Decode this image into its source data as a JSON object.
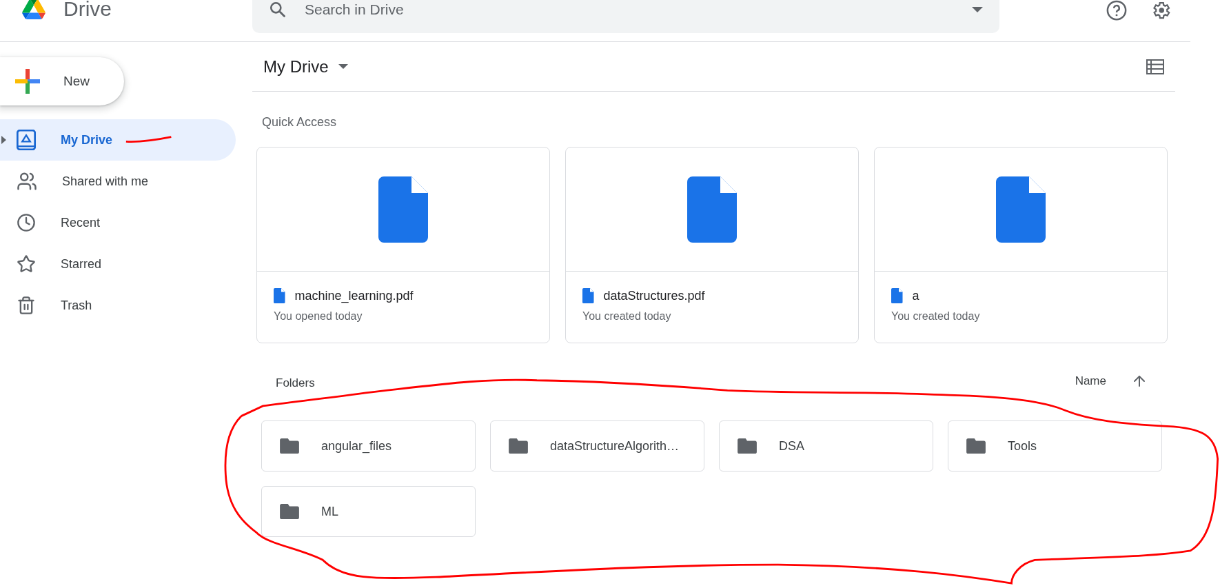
{
  "header": {
    "logo_text": "Drive",
    "search": {
      "placeholder": "Search in Drive"
    }
  },
  "sidebar": {
    "new_button": "New",
    "items": [
      {
        "label": "My Drive",
        "selected": true,
        "expandable": true
      },
      {
        "label": "Shared with me",
        "selected": false,
        "expandable": false
      },
      {
        "label": "Recent",
        "selected": false,
        "expandable": false
      },
      {
        "label": "Starred",
        "selected": false,
        "expandable": false
      },
      {
        "label": "Trash",
        "selected": false,
        "expandable": false
      }
    ]
  },
  "main": {
    "title": "My Drive",
    "quick_access": {
      "heading": "Quick Access",
      "files": [
        {
          "name": "machine_learning.pdf",
          "subtitle": "You opened today"
        },
        {
          "name": "dataStructures.pdf",
          "subtitle": "You created today"
        },
        {
          "name": "a",
          "subtitle": "You created today"
        }
      ]
    },
    "folders": {
      "heading": "Folders",
      "sort_label": "Name",
      "items": [
        {
          "name": "angular_files"
        },
        {
          "name": "dataStructureAlgorith…"
        },
        {
          "name": "DSA"
        },
        {
          "name": "Tools"
        },
        {
          "name": "ML"
        }
      ]
    }
  }
}
